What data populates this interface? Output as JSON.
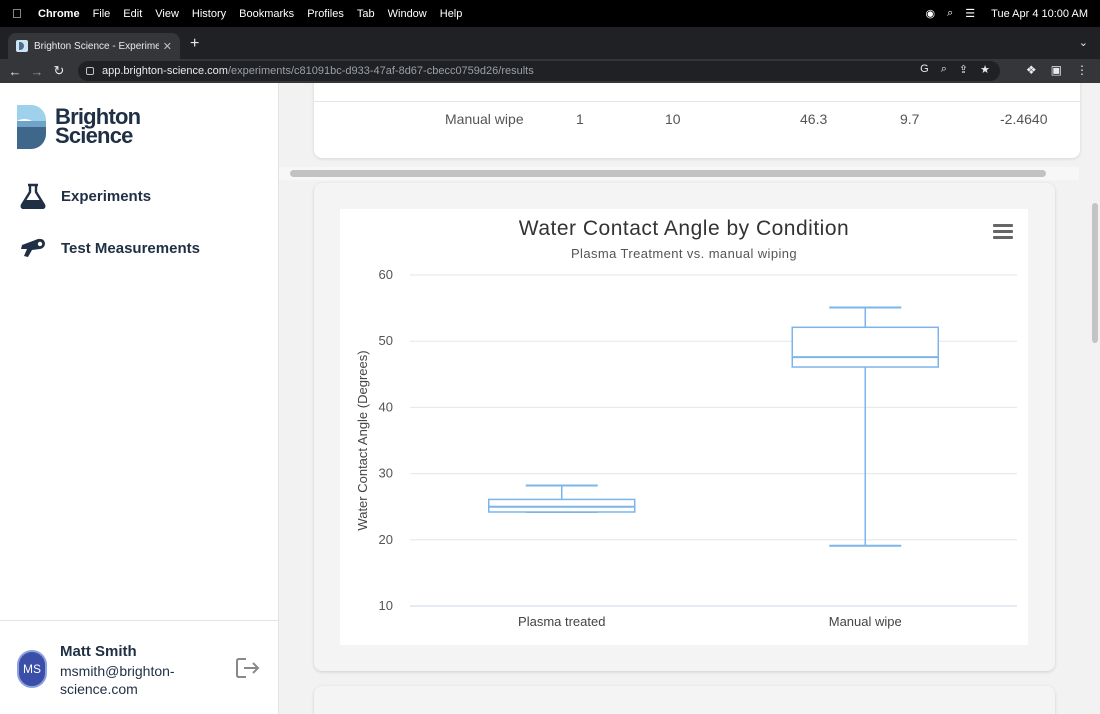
{
  "menubar": {
    "app": "Chrome",
    "items": [
      "File",
      "Edit",
      "View",
      "History",
      "Bookmarks",
      "Profiles",
      "Tab",
      "Window",
      "Help"
    ],
    "clock": "Tue Apr 4  10:00 AM"
  },
  "browser": {
    "tab_title": "Brighton Science - Experiment",
    "url_domain": "app.brighton-science.com",
    "url_path": "/experiments/c81091bc-d933-47af-8d67-cbecc0759d26/results"
  },
  "sidebar": {
    "logo_line1": "Brighton",
    "logo_line2": "Science",
    "nav": [
      {
        "label": "Experiments",
        "icon": "flask-icon"
      },
      {
        "label": "Test Measurements",
        "icon": "measurement-gun-icon"
      }
    ],
    "user": {
      "initials": "MS",
      "name": "Matt Smith",
      "email": "msmith@brighton-science.com"
    }
  },
  "table": {
    "row": [
      "Manual wipe",
      "1",
      "10",
      "46.3",
      "9.7",
      "-2.4640"
    ]
  },
  "chart_data": {
    "type": "boxplot",
    "title": "Water Contact Angle by Condition",
    "subtitle": "Plasma Treatment vs. manual wiping",
    "ylabel": "Water Contact Angle (Degrees)",
    "xlabel": "",
    "categories": [
      "Plasma treated",
      "Manual wipe"
    ],
    "series": [
      {
        "boxes": [
          {
            "category": "Plasma treated",
            "low": 24.2,
            "q1": 24.2,
            "median": 25.0,
            "q3": 26.1,
            "high": 28.2
          },
          {
            "category": "Manual wipe",
            "low": 19.1,
            "q1": 46.1,
            "median": 47.6,
            "q3": 52.1,
            "high": 55.1
          }
        ]
      }
    ],
    "ylim": [
      10,
      60
    ],
    "yticks": [
      10,
      20,
      30,
      40,
      50,
      60
    ],
    "grid": true,
    "color": "#7cb5ec"
  }
}
